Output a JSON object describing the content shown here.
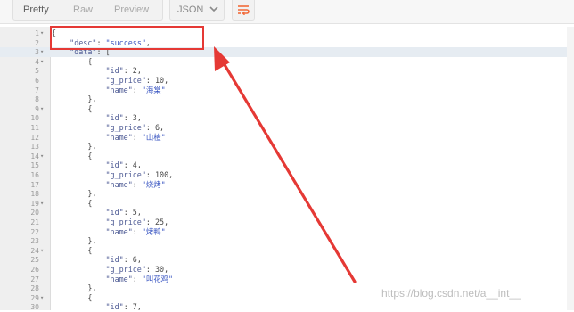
{
  "toolbar": {
    "view_modes": [
      "Pretty",
      "Raw",
      "Preview"
    ],
    "active_view": "Pretty",
    "format_label": "JSON",
    "accent_color": "#f26b3a"
  },
  "editor": {
    "lines": [
      {
        "n": "1",
        "fold": true,
        "t": "{"
      },
      {
        "n": "2",
        "fold": false,
        "t": "    \"desc\": \"success\","
      },
      {
        "n": "3",
        "fold": true,
        "t": "    \"data\": ["
      },
      {
        "n": "4",
        "fold": true,
        "t": "        {"
      },
      {
        "n": "5",
        "fold": false,
        "t": "            \"id\": 2,"
      },
      {
        "n": "6",
        "fold": false,
        "t": "            \"g_price\": 10,"
      },
      {
        "n": "7",
        "fold": false,
        "t": "            \"name\": \"海棠\""
      },
      {
        "n": "8",
        "fold": false,
        "t": "        },"
      },
      {
        "n": "9",
        "fold": true,
        "t": "        {"
      },
      {
        "n": "10",
        "fold": false,
        "t": "            \"id\": 3,"
      },
      {
        "n": "11",
        "fold": false,
        "t": "            \"g_price\": 6,"
      },
      {
        "n": "12",
        "fold": false,
        "t": "            \"name\": \"山楂\""
      },
      {
        "n": "13",
        "fold": false,
        "t": "        },"
      },
      {
        "n": "14",
        "fold": true,
        "t": "        {"
      },
      {
        "n": "15",
        "fold": false,
        "t": "            \"id\": 4,"
      },
      {
        "n": "16",
        "fold": false,
        "t": "            \"g_price\": 100,"
      },
      {
        "n": "17",
        "fold": false,
        "t": "            \"name\": \"烧烤\""
      },
      {
        "n": "18",
        "fold": false,
        "t": "        },"
      },
      {
        "n": "19",
        "fold": true,
        "t": "        {"
      },
      {
        "n": "20",
        "fold": false,
        "t": "            \"id\": 5,"
      },
      {
        "n": "21",
        "fold": false,
        "t": "            \"g_price\": 25,"
      },
      {
        "n": "22",
        "fold": false,
        "t": "            \"name\": \"烤鸭\""
      },
      {
        "n": "23",
        "fold": false,
        "t": "        },"
      },
      {
        "n": "24",
        "fold": true,
        "t": "        {"
      },
      {
        "n": "25",
        "fold": false,
        "t": "            \"id\": 6,"
      },
      {
        "n": "26",
        "fold": false,
        "t": "            \"g_price\": 30,"
      },
      {
        "n": "27",
        "fold": false,
        "t": "            \"name\": \"叫花鸡\""
      },
      {
        "n": "28",
        "fold": false,
        "t": "        },"
      },
      {
        "n": "29",
        "fold": true,
        "t": "        {"
      },
      {
        "n": "30",
        "fold": false,
        "t": "            \"id\": 7,"
      }
    ],
    "highlighted_line": "3"
  },
  "annotation": {
    "color": "#e53935"
  },
  "watermark": "https://blog.csdn.net/a__int__"
}
